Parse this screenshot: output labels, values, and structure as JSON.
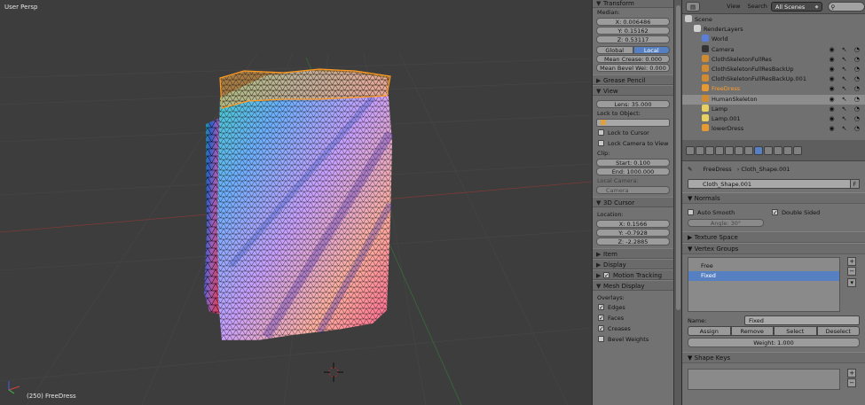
{
  "viewport": {
    "view_label": "User Persp",
    "status_label": "(250) FreeDress"
  },
  "npanel": {
    "transform_header": "Transform",
    "median_label": "Median:",
    "x_value": "X: 0.006486",
    "y_value": "Y: 0.15162",
    "z_value": "Z: 0.53117",
    "global_label": "Global",
    "local_label": "Local",
    "mean_crease": "Mean Crease: 0.000",
    "mean_bevel": "Mean Bevel Wei: 0.000",
    "grease_pencil_header": "Grease Pencil",
    "view_header": "View",
    "lens_value": "Lens: 35.000",
    "lock_to_object_label": "Lock to Object:",
    "lock_to_cursor_label": "Lock to Cursor",
    "lock_camera_label": "Lock Camera to View",
    "clip_label": "Clip:",
    "clip_start": "Start: 0.100",
    "clip_end": "End: 1000.000",
    "local_camera_label": "Local Camera:",
    "camera_field": "Camera",
    "cursor_header": "3D Cursor",
    "location_label": "Location:",
    "cursor_x": "X: 0.1566",
    "cursor_y": "Y: -0.7928",
    "cursor_z": "Z: -2.2885",
    "item_header": "Item",
    "display_header": "Display",
    "motion_tracking_header": "Motion Tracking",
    "mesh_display_header": "Mesh Display",
    "overlays_label": "Overlays:",
    "edges_label": "Edges",
    "faces_label": "Faces",
    "creases_label": "Creases",
    "bevel_weights_label": "Bevel Weights"
  },
  "outliner": {
    "view_menu": "View",
    "search_menu": "Search",
    "scene_selector": "All Scenes",
    "items": [
      {
        "label": "Scene",
        "icon": "scene-icon"
      },
      {
        "label": "RenderLayers",
        "icon": "render-layers-icon"
      },
      {
        "label": "World",
        "icon": "world-icon"
      },
      {
        "label": "Camera",
        "icon": "camera-icon"
      },
      {
        "label": "ClothSkeletonFullRes",
        "icon": "armature-icon"
      },
      {
        "label": "ClothSkeletonFullResBackUp",
        "icon": "armature-icon"
      },
      {
        "label": "ClothSkeletonFullResBackUp.001",
        "icon": "armature-icon"
      },
      {
        "label": "FreeDress",
        "icon": "mesh-icon"
      },
      {
        "label": "HumanSkeleton",
        "icon": "armature-icon"
      },
      {
        "label": "Lamp",
        "icon": "lamp-icon"
      },
      {
        "label": "Lamp.001",
        "icon": "lamp-icon"
      },
      {
        "label": "lowerDress",
        "icon": "mesh-icon"
      }
    ]
  },
  "properties": {
    "crumb_object": "FreeDress",
    "crumb_data": "Cloth_Shape.001",
    "data_name": "Cloth_Shape.001",
    "fake_user_label": "F",
    "normals_header": "Normals",
    "auto_smooth_label": "Auto Smooth",
    "double_sided_label": "Double Sided",
    "angle_field": "Angle: 30°",
    "texture_space_header": "Texture Space",
    "vertex_groups_header": "Vertex Groups",
    "vertex_groups": [
      "Free",
      "Fixed"
    ],
    "name_label": "Name:",
    "name_value": "Fixed",
    "assign_label": "Assign",
    "remove_label": "Remove",
    "select_label": "Select",
    "deselect_label": "Deselect",
    "weight_field": "Weight: 1.000",
    "shape_keys_header": "Shape Keys"
  }
}
